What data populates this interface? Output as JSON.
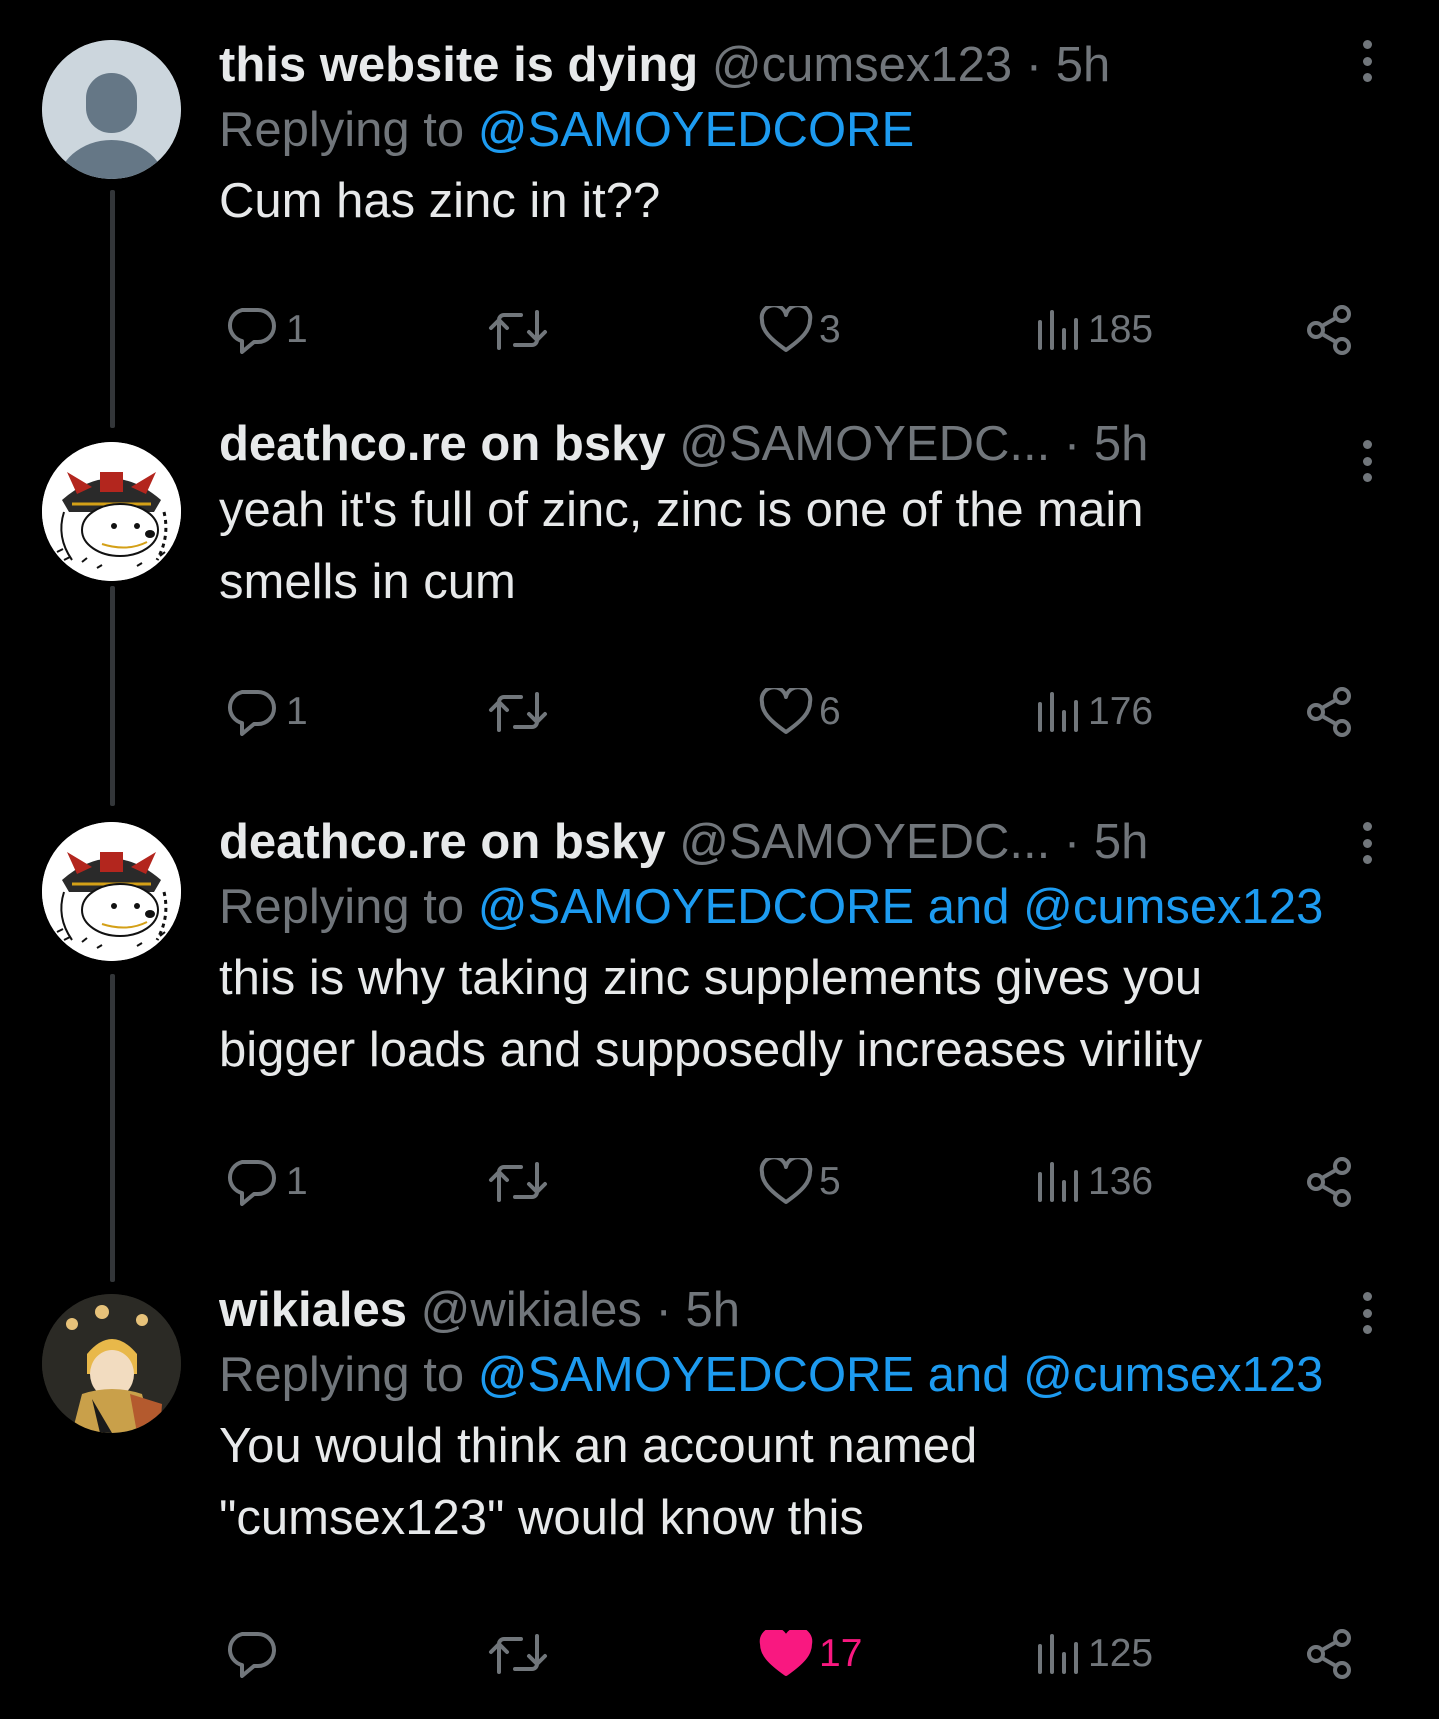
{
  "colors": {
    "background": "#000000",
    "text": "#e7e9ea",
    "muted": "#71767b",
    "link": "#1d9bf0",
    "like_active": "#f91880"
  },
  "posts": [
    {
      "name": "this website is dying",
      "handle": "@cumsex123",
      "separator": "·",
      "time": "5h",
      "replying_prefix": "Replying to ",
      "replying_to": "@SAMOYEDCORE",
      "text": "Cum has zinc in it??",
      "replies": "1",
      "likes": "3",
      "views": "185",
      "avatar_icon": "default-avatar-icon"
    },
    {
      "name": "deathco.re on bsky",
      "handle": "@SAMOYEDC...",
      "separator": "·",
      "time": "5h",
      "text": "yeah it's full of zinc, zinc is one of the main\nsmells in cum",
      "replies": "1",
      "likes": "6",
      "views": "176",
      "avatar_icon": "samoyed-samurai-avatar"
    },
    {
      "name": "deathco.re on bsky",
      "handle": "@SAMOYEDC...",
      "separator": "·",
      "time": "5h",
      "replying_prefix": "Replying to ",
      "replying_to": "@SAMOYEDCORE and @cumsex123",
      "text": "this is why taking zinc supplements gives you\nbigger loads and supposedly increases virility",
      "replies": "1",
      "likes": "5",
      "views": "136",
      "avatar_icon": "samoyed-samurai-avatar"
    },
    {
      "name": "wikiales",
      "handle": "@wikiales",
      "separator": "·",
      "time": "5h",
      "replying_prefix": "Replying to ",
      "replying_to": "@SAMOYEDCORE and @cumsex123",
      "text": "You would think an account named\n\"cumsex123\" would know this",
      "replies": "",
      "likes": "17",
      "liked": true,
      "views": "125",
      "avatar_icon": "anime-character-avatar"
    }
  ]
}
